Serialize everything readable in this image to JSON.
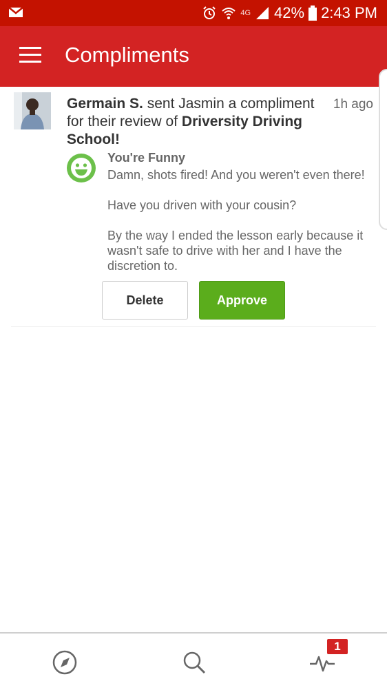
{
  "status_bar": {
    "network_label": "4G",
    "battery_percent": "42%",
    "time": "2:43 PM"
  },
  "header": {
    "title": "Compliments"
  },
  "compliment": {
    "sender": "Germain S.",
    "action_text": " sent Jasmin a compliment for their review of ",
    "business": "Driversity Driving School!",
    "time_ago": "1h ago",
    "type": "You're Funny",
    "message_lines": [
      "Damn, shots fired! And you weren't even there!",
      "Have you driven with your cousin?",
      "By the way I ended the lesson early because it wasn't safe to drive with her and I have the discretion to."
    ],
    "delete_label": "Delete",
    "approve_label": "Approve"
  },
  "bottom_nav": {
    "items": [
      "compass-icon",
      "search-icon",
      "activity-icon"
    ],
    "activity_badge": "1"
  },
  "colors": {
    "brand_red": "#d32323",
    "approve_green": "#5bad1c",
    "smiley_green": "#6cc04a"
  }
}
